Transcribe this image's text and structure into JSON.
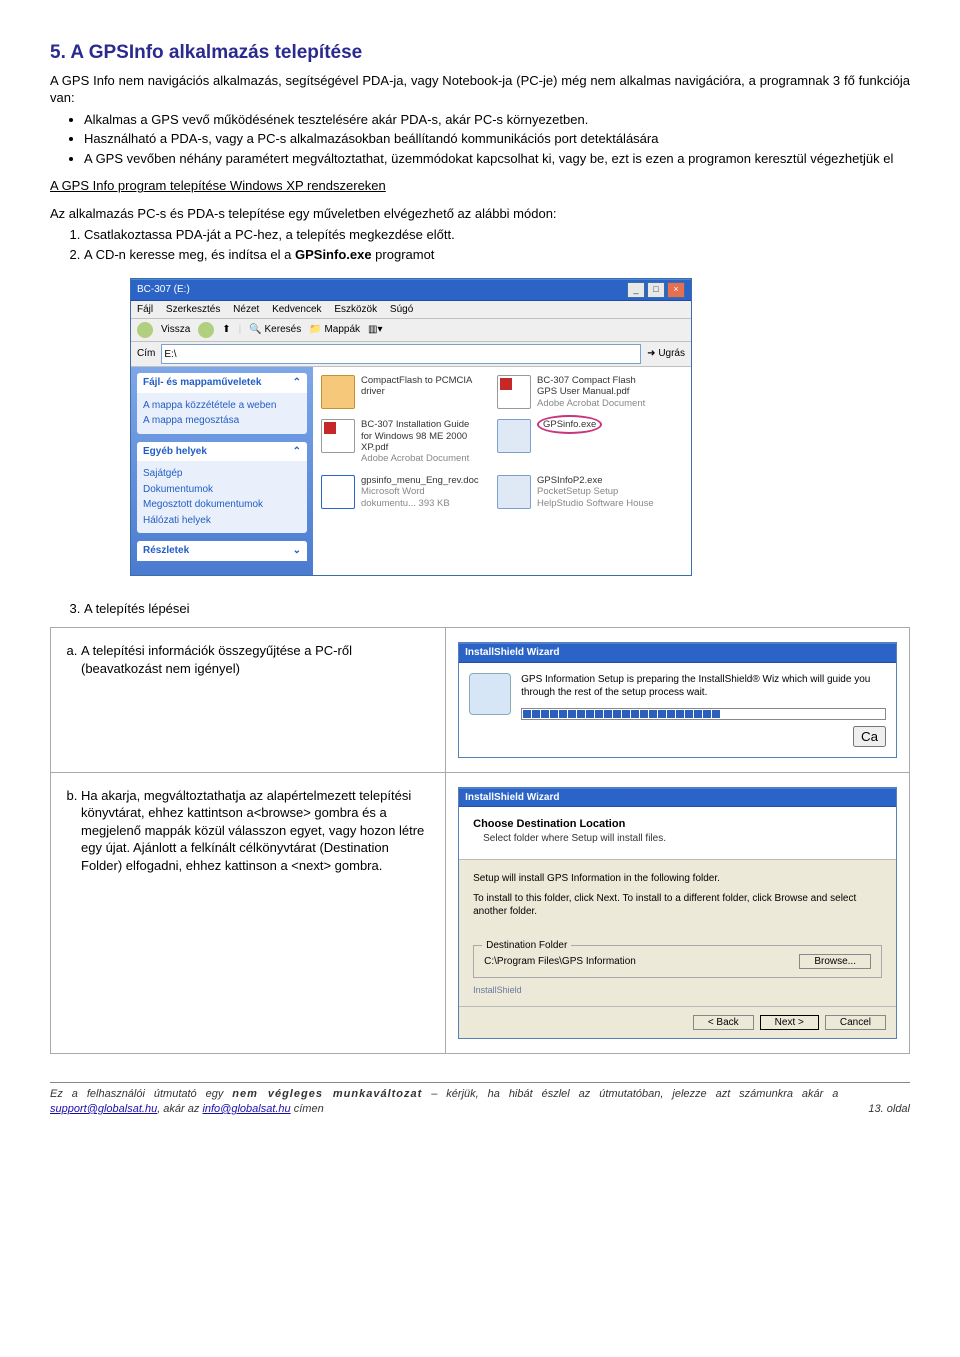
{
  "section": {
    "title": "5. A GPSInfo alkalmazás telepítése",
    "intro": "A GPS Info nem navigációs alkalmazás, segítségével PDA-ja, vagy Notebook-ja (PC-je) még nem alkalmas navigációra, a programnak 3 fő funkciója van:",
    "bullets": [
      "Alkalmas a GPS vevő működésének tesztelésére akár PDA-s, akár PC-s környezetben.",
      "Használható a PDA-s, vagy a PC-s alkalmazásokban beállítandó kommunikációs port detektálására",
      "A GPS vevőben néhány paramétert megváltoztathat, üzemmódokat kapcsolhat ki, vagy be, ezt is ezen a programon keresztül végezhetjük el"
    ],
    "sub_heading": "A GPS Info program telepítése Windows XP rendszereken",
    "sub_heading_link": "Windows XP",
    "intro2": "Az alkalmazás PC-s és PDA-s telepítése egy műveletben elvégezhető az alábbi módon:",
    "steps12": [
      "Csatlakoztassa PDA-ját a PC-hez, a telepítés megkezdése előtt.",
      "A CD-n keresse meg, és indítsa el a GPSinfo.exe programot"
    ],
    "step3_label": "A telepítés lépései"
  },
  "explorer": {
    "title": "BC-307 (E:)",
    "menu": [
      "Fájl",
      "Szerkesztés",
      "Nézet",
      "Kedvencek",
      "Eszközök",
      "Súgó"
    ],
    "toolbar": {
      "back": "Vissza",
      "search": "Keresés",
      "folders": "Mappák"
    },
    "addr_label": "Cím",
    "addr_value": "E:\\",
    "go": "Ugrás",
    "sidegroups": {
      "tasks": {
        "title": "Fájl- és mappaműveletek",
        "items": [
          "A mappa közzététele a weben",
          "A mappa megosztása"
        ]
      },
      "places": {
        "title": "Egyéb helyek",
        "items": [
          "Sajátgép",
          "Dokumentumok",
          "Megosztott dokumentumok",
          "Hálózati helyek"
        ]
      },
      "details": {
        "title": "Részletek"
      }
    },
    "files": [
      {
        "icon": "folder",
        "name": "CompactFlash to PCMCIA driver",
        "sub": ""
      },
      {
        "icon": "pdf",
        "name": "BC-307 Compact Flash GPS User Manual.pdf",
        "sub": "Adobe Acrobat Document"
      },
      {
        "icon": "pdf",
        "name": "BC-307 Installation Guide for Windows 98 ME 2000 XP.pdf",
        "sub": "Adobe Acrobat Document"
      },
      {
        "icon": "exe",
        "name": "GPSinfo.exe",
        "sub": "",
        "highlight": true
      },
      {
        "icon": "doc",
        "name": "gpsinfo_menu_Eng_rev.doc",
        "sub": "Microsoft Word dokumentu...  393 KB"
      },
      {
        "icon": "exe",
        "name": "GPSInfoP2.exe",
        "sub": "PocketSetup Setup  HelpStudio Software House"
      }
    ]
  },
  "substeps": {
    "a": "A telepítési információk összegyűjtése a PC-ről (beavatkozást nem igényel)",
    "b": "Ha akarja, megváltoztathatja az alapértelmezett telepítési könyvtárat, ehhez kattintson a<browse> gombra és a megjelenő mappák közül válasszon egyet, vagy hozon létre egy újat. Ajánlott a felkínált célkönyvtárat (Destination Folder) elfogadni, ehhez kattinson a <next> gombra."
  },
  "wiz1": {
    "title": "InstallShield Wizard",
    "text": "GPS Information Setup is preparing the InstallShield® Wiz which will guide you through the rest of the setup process wait.",
    "cancel": "Ca"
  },
  "wiz2": {
    "title": "InstallShield Wizard",
    "head1": "Choose Destination Location",
    "head2": "Select folder where Setup will install files.",
    "line1": "Setup will install GPS Information in the following folder.",
    "line2": "To install to this folder, click Next. To install to a different folder, click Browse and select another folder.",
    "dest_label": "Destination Folder",
    "dest_path": "C:\\Program Files\\GPS Information",
    "browse": "Browse...",
    "back": "< Back",
    "next": "Next >",
    "cancel": "Cancel",
    "brand": "InstallShield"
  },
  "footer": {
    "text_pre": "Ez a felhasználói útmutató egy ",
    "text_bold": "nem végleges munkaváltozat",
    "text_mid": " – kérjük, ha hibát észlel az útmutatóban, jelezze azt számunkra akár a ",
    "link1": "support@globalsat.hu",
    "text_mid2": ", akár az ",
    "link2": "info@globalsat.hu",
    "text_end": " címen",
    "page": "13. oldal"
  }
}
